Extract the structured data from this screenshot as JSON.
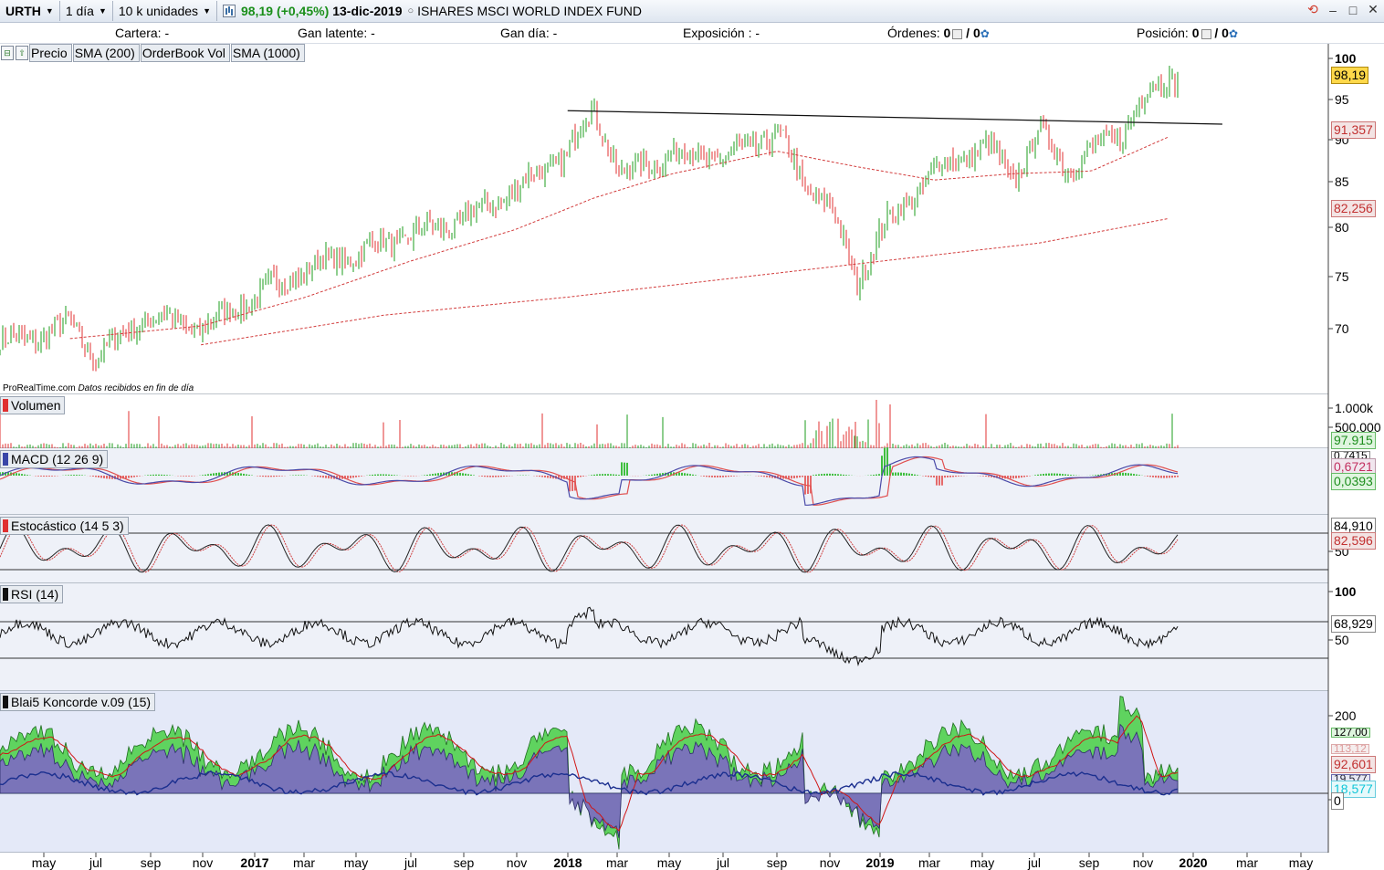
{
  "toolbar": {
    "symbol": "URTH",
    "timeframe": "1 día",
    "units": "10 k unidades",
    "price": "98,19",
    "change": "(+0,45%)",
    "date": "13-dic-2019",
    "instrument": "ISHARES MSCI WORLD INDEX FUND",
    "icons": [
      "chart-icon",
      "refresh-icon",
      "minimize-icon",
      "maximize-icon",
      "close-icon"
    ]
  },
  "status": {
    "cartera": "Cartera: -",
    "gan_latente": "Gan latente: -",
    "gan_dia": "Gan día: -",
    "exposicion": "Exposición : -",
    "ordenes_label": "Órdenes:",
    "ordenes_a": "0",
    "ordenes_b": "/ 0",
    "posicion_label": "Posición:",
    "posicion_a": "0",
    "posicion_b": "/ 0"
  },
  "legends": {
    "price": [
      "Precio",
      "SMA (200)",
      "OrderBook Vol",
      "SMA (1000)"
    ],
    "volume": "Volumen",
    "macd": "MACD (12 26 9)",
    "stoch": "Estocástico (14 5 3)",
    "rsi": "RSI (14)",
    "koncorde": "Blai5 Koncorde v.09 (15)"
  },
  "watermark": {
    "brand": "ProRealTime.com",
    "note": "Datos recibidos en fin de día"
  },
  "axis": {
    "price_ticks": [
      "100",
      "95",
      "90",
      "85",
      "80",
      "75",
      "70"
    ],
    "volume_ticks": [
      "1.000k",
      "500.000"
    ],
    "stoch_ticks": [
      "50"
    ],
    "rsi_ticks": [
      "100",
      "50"
    ],
    "koncorde_ticks": [
      "200",
      "0"
    ],
    "x_ticks": [
      {
        "label": "may",
        "year": false
      },
      {
        "label": "jul",
        "year": false
      },
      {
        "label": "sep",
        "year": false
      },
      {
        "label": "nov",
        "year": false
      },
      {
        "label": "2017",
        "year": true
      },
      {
        "label": "mar",
        "year": false
      },
      {
        "label": "may",
        "year": false
      },
      {
        "label": "jul",
        "year": false
      },
      {
        "label": "sep",
        "year": false
      },
      {
        "label": "nov",
        "year": false
      },
      {
        "label": "2018",
        "year": true
      },
      {
        "label": "mar",
        "year": false
      },
      {
        "label": "may",
        "year": false
      },
      {
        "label": "jul",
        "year": false
      },
      {
        "label": "sep",
        "year": false
      },
      {
        "label": "nov",
        "year": false
      },
      {
        "label": "2019",
        "year": true
      },
      {
        "label": "mar",
        "year": false
      },
      {
        "label": "may",
        "year": false
      },
      {
        "label": "jul",
        "year": false
      },
      {
        "label": "sep",
        "year": false
      },
      {
        "label": "nov",
        "year": false
      },
      {
        "label": "2020",
        "year": true
      },
      {
        "label": "mar",
        "year": false
      },
      {
        "label": "may",
        "year": false
      }
    ]
  },
  "values": {
    "price_last": "98,19",
    "sma200": "91,357",
    "sma1000": "82,256",
    "volume_last": "97.915",
    "macd_hidden": "0,7415",
    "macd": "0,6721",
    "macd_hist": "0,0393",
    "stoch_k": "84,910",
    "stoch_d": "82,596",
    "rsi": "68,929",
    "konc_a": "127,00",
    "konc_b": "113,12",
    "konc_red": "92,601",
    "konc_c": "19,577",
    "konc_blue": "18,577",
    "konc_zero": "0"
  },
  "colors": {
    "up": "#1e9e1e",
    "down": "#e03030",
    "sma": "#d23c3c",
    "blue": "#1b2f8f",
    "purple": "#7a74b9",
    "green_fill": "#5fd35f",
    "price_box": "#ffd84a",
    "hist_green": "#3fbf3f",
    "hist_red": "#e56a6a",
    "cyan": "#11d6e8"
  },
  "chart_data": {
    "type": "line",
    "title": "ISHARES MSCI WORLD INDEX FUND",
    "xlabel": "",
    "ylabel": "",
    "x_range": [
      "2016-04",
      "2020-05"
    ],
    "ylim": [
      66,
      101
    ],
    "series": [
      {
        "name": "Precio",
        "x": [
          "2016-04",
          "2016-06",
          "2016-07",
          "2016-09",
          "2016-11",
          "2017-01",
          "2017-03",
          "2017-05",
          "2017-07",
          "2017-09",
          "2017-11",
          "2018-01",
          "2018-02",
          "2018-03",
          "2018-05",
          "2018-07",
          "2018-09",
          "2018-10",
          "2018-11",
          "2018-12",
          "2019-01",
          "2019-03",
          "2019-05",
          "2019-06",
          "2019-07",
          "2019-08",
          "2019-09",
          "2019-10",
          "2019-11",
          "2019-12"
        ],
        "values": [
          68.5,
          70.5,
          67,
          71.5,
          70,
          73.5,
          76.5,
          78.5,
          80.5,
          82,
          85.5,
          89.5,
          94.5,
          87,
          89.5,
          89,
          91.8,
          86,
          84,
          75,
          81,
          87.5,
          90.5,
          86.5,
          92,
          88,
          89.5,
          91.5,
          95.5,
          98.19
        ]
      },
      {
        "name": "SMA (200)",
        "x": [
          "2016-06",
          "2016-11",
          "2017-03",
          "2017-07",
          "2017-11",
          "2018-02",
          "2018-05",
          "2018-09",
          "2018-12",
          "2019-03",
          "2019-06",
          "2019-09",
          "2019-12"
        ],
        "values": [
          68.9,
          70.3,
          73.5,
          77.5,
          81,
          84.5,
          87.2,
          89.7,
          88,
          86.5,
          87.2,
          87.5,
          91.357
        ]
      },
      {
        "name": "SMA (1000)",
        "x": [
          "2016-11",
          "2017-06",
          "2018-01",
          "2018-07",
          "2019-01",
          "2019-07",
          "2019-12"
        ],
        "values": [
          68.2,
          71.5,
          73.5,
          75.5,
          77.5,
          79.5,
          82.256
        ]
      }
    ],
    "annotations": [
      {
        "type": "trendline",
        "from": [
          "2018-01",
          94.2
        ],
        "to": [
          "2020-02",
          92.7
        ]
      }
    ]
  }
}
